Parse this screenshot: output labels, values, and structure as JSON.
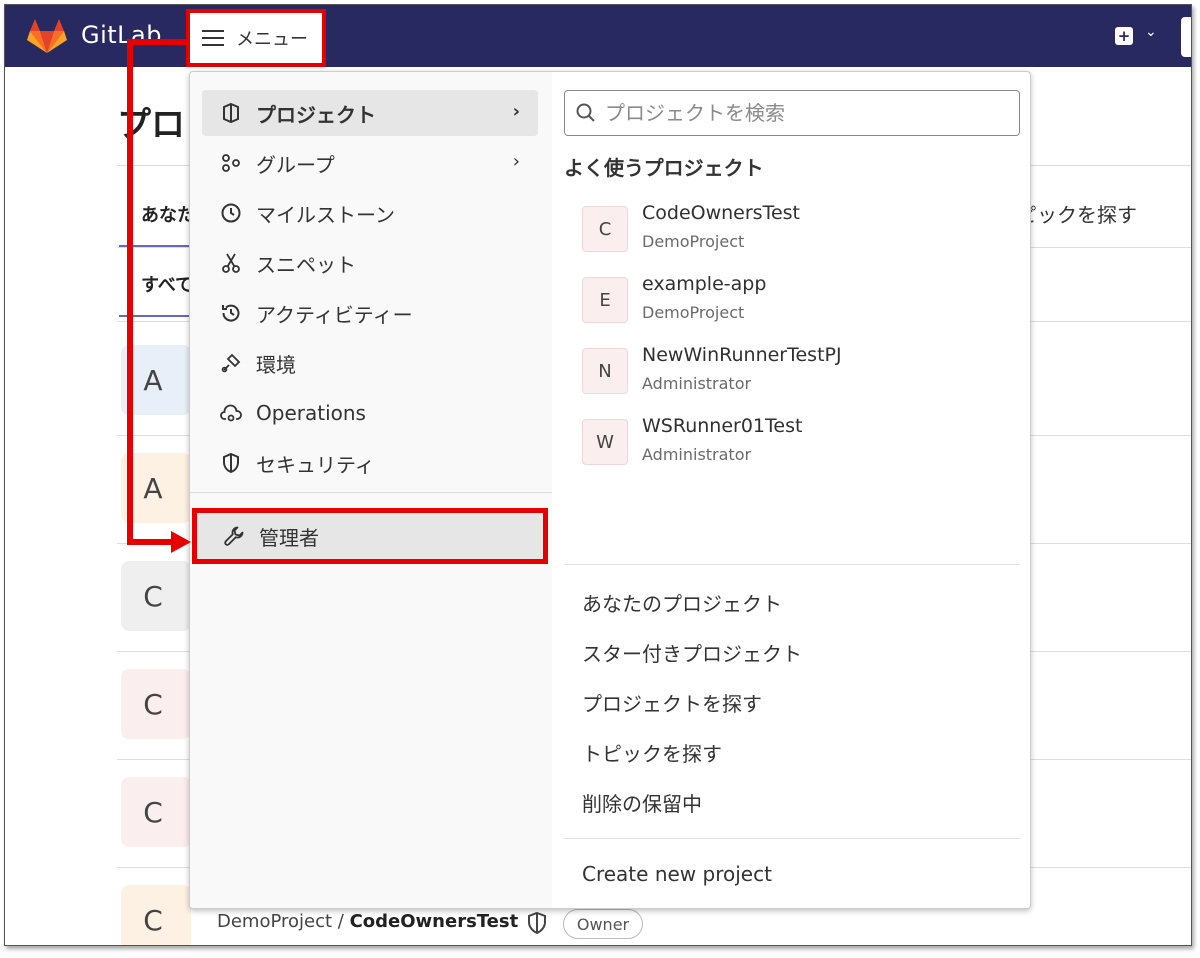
{
  "topbar": {
    "brand": "GitLab",
    "menu_label": "メニュー",
    "caret": "⌄"
  },
  "background": {
    "page_title": "プロ",
    "tab_left": "あなた",
    "tab_right": "ピックを探す",
    "subtab": "すべて",
    "avatars": [
      "A",
      "A",
      "C",
      "C",
      "C",
      "C"
    ],
    "bottom_row": {
      "namespace": "DemoProject / ",
      "project": "CodeOwnersTest",
      "badge": "Owner"
    }
  },
  "menu": {
    "nav_items": [
      {
        "label": "プロジェクト",
        "icon": "project-icon",
        "has_chevron": true
      },
      {
        "label": "グループ",
        "icon": "group-icon",
        "has_chevron": true
      },
      {
        "label": "マイルストーン",
        "icon": "clock-icon",
        "has_chevron": false
      },
      {
        "label": "スニペット",
        "icon": "scissors-icon",
        "has_chevron": false
      },
      {
        "label": "アクティビティー",
        "icon": "history-icon",
        "has_chevron": false
      },
      {
        "label": "環境",
        "icon": "environment-icon",
        "has_chevron": false
      },
      {
        "label": "Operations",
        "icon": "cloud-gear-icon",
        "has_chevron": false
      },
      {
        "label": "セキュリティ",
        "icon": "shield-icon",
        "has_chevron": false
      }
    ],
    "admin_label": "管理者",
    "chevron": "›",
    "search_placeholder": "プロジェクトを検索",
    "frequent_title": "よく使うプロジェクト",
    "frequent_projects": [
      {
        "initial": "C",
        "name": "CodeOwnersTest",
        "namespace": "DemoProject"
      },
      {
        "initial": "E",
        "name": "example-app",
        "namespace": "DemoProject"
      },
      {
        "initial": "N",
        "name": "NewWinRunnerTestPJ",
        "namespace": "Administrator"
      },
      {
        "initial": "W",
        "name": "WSRunner01Test",
        "namespace": "Administrator"
      }
    ],
    "links": [
      "あなたのプロジェクト",
      "スター付きプロジェクト",
      "プロジェクトを探す",
      "トピックを探す",
      "削除の保留中"
    ],
    "create_link": "Create new project"
  },
  "colors": {
    "topbar_bg": "#292961",
    "highlight_red": "#e60000",
    "accent_underline": "#6666c4"
  }
}
